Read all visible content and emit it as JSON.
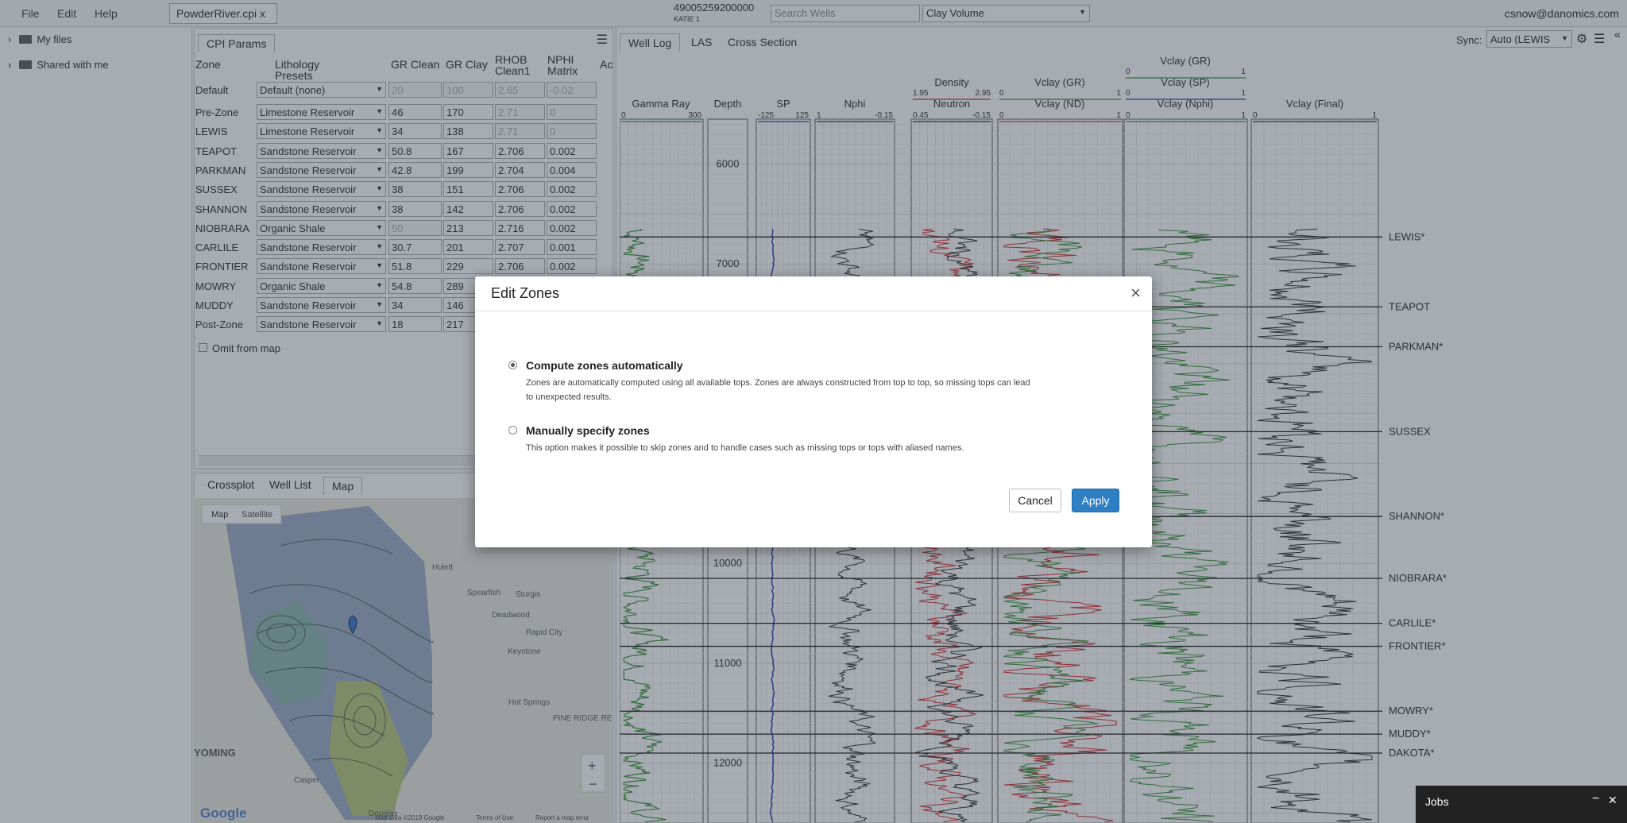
{
  "menu": {
    "file": "File",
    "edit": "Edit",
    "help": "Help"
  },
  "file_tab": "PowderRiver.cpi x",
  "well": {
    "id": "49005259200000",
    "name": "KATIE 1"
  },
  "search_placeholder": "Search Wells",
  "curve_select": "Clay Volume",
  "user": "csnow@danomics.com",
  "tree": [
    "My files",
    "Shared with me"
  ],
  "cpi": {
    "tab": "CPI Params",
    "headers": [
      "Zone",
      "Lithology Presets",
      "GR Clean",
      "GR Clay",
      "RHOB Clean1",
      "NPHI Matrix",
      "Ac"
    ],
    "rows": [
      {
        "zone": "Default",
        "preset": "Default (none)",
        "gr_clean": "20",
        "gr_clay": "100",
        "rhob": "2.65",
        "nphi": "-0.02"
      },
      {
        "zone": "Pre-Zone",
        "preset": "Limestone Reservoir",
        "gr_clean": "46",
        "gr_clay": "170",
        "rhob": "2.71",
        "nphi": "0"
      },
      {
        "zone": "LEWIS",
        "preset": "Limestone Reservoir",
        "gr_clean": "34",
        "gr_clay": "138",
        "rhob": "2.71",
        "nphi": "0"
      },
      {
        "zone": "TEAPOT",
        "preset": "Sandstone Reservoir",
        "gr_clean": "50.8",
        "gr_clay": "167",
        "rhob": "2.706",
        "nphi": "0.002"
      },
      {
        "zone": "PARKMAN",
        "preset": "Sandstone Reservoir",
        "gr_clean": "42.8",
        "gr_clay": "199",
        "rhob": "2.704",
        "nphi": "0.004"
      },
      {
        "zone": "SUSSEX",
        "preset": "Sandstone Reservoir",
        "gr_clean": "38",
        "gr_clay": "151",
        "rhob": "2.706",
        "nphi": "0.002"
      },
      {
        "zone": "SHANNON",
        "preset": "Sandstone Reservoir",
        "gr_clean": "38",
        "gr_clay": "142",
        "rhob": "2.706",
        "nphi": "0.002"
      },
      {
        "zone": "NIOBRARA",
        "preset": "Organic Shale",
        "gr_clean": "50",
        "gr_clay": "213",
        "rhob": "2.716",
        "nphi": "0.002"
      },
      {
        "zone": "CARLILE",
        "preset": "Sandstone Reservoir",
        "gr_clean": "30.7",
        "gr_clay": "201",
        "rhob": "2.707",
        "nphi": "0.001"
      },
      {
        "zone": "FRONTIER",
        "preset": "Sandstone Reservoir",
        "gr_clean": "51.8",
        "gr_clay": "229",
        "rhob": "2.706",
        "nphi": "0.002"
      },
      {
        "zone": "MOWRY",
        "preset": "Organic Shale",
        "gr_clean": "54.8",
        "gr_clay": "289",
        "rhob": "2.706",
        "nphi": "0.002"
      },
      {
        "zone": "MUDDY",
        "preset": "Sandstone Reservoir",
        "gr_clean": "34",
        "gr_clay": "146",
        "rhob": "2.706",
        "nphi": "0.002"
      },
      {
        "zone": "Post-Zone",
        "preset": "Sandstone Reservoir",
        "gr_clean": "18",
        "gr_clay": "217",
        "rhob": "2.706",
        "nphi": "0.002"
      }
    ],
    "omit_label": "Omit from map"
  },
  "bottom_tabs": [
    "Crossplot",
    "Well List",
    "Map"
  ],
  "map": {
    "btn_map": "Map",
    "btn_sat": "Satellite",
    "places": [
      "Hulett",
      "Spearfish",
      "Sturgis",
      "Deadwood",
      "Rapid City",
      "Keystone",
      "Hot Springs",
      "PINE RIDGE RESERVATION",
      "Casper",
      "Douglas",
      "YOMING"
    ],
    "attribution": [
      "Map data ©2019 Google",
      "Terms of Use",
      "Report a map error"
    ],
    "google": "Google",
    "zoom_in": "+",
    "zoom_out": "−"
  },
  "right_tabs": [
    "Well Log",
    "LAS",
    "Cross Section"
  ],
  "sync_label": "Sync:",
  "sync_value": "Auto (LEWIS",
  "tracks": {
    "gamma": {
      "title": "Gamma Ray",
      "min": "0",
      "max": "300"
    },
    "depth": {
      "title": "Depth"
    },
    "sp": {
      "title": "SP",
      "min": "-125",
      "max": "125"
    },
    "nphi": {
      "title": "Nphi",
      "min": "1",
      "max": "-0.15"
    },
    "dens": {
      "title1": "Density",
      "min1": "1.95",
      "max1": "2.95",
      "title2": "Neutron",
      "min2": "0.45",
      "max2": "-0.15"
    },
    "vclay1": {
      "title1": "Vclay (GR)",
      "min1": "0",
      "max1": "1",
      "title2": "Vclay (ND)",
      "min2": "0",
      "max2": "1"
    },
    "vclay2": {
      "title1": "Vclay (GR)",
      "min1": "0",
      "max1": "1",
      "title2": "Vclay (SP)",
      "min2": "0",
      "max2": "1",
      "title3": "Vclay (Nphi)",
      "min3": "0",
      "max3": "1"
    },
    "vfinal": {
      "title": "Vclay (Final)",
      "min": "0",
      "max": "1"
    }
  },
  "depths": [
    "6000",
    "7000",
    "10000",
    "11000",
    "12000"
  ],
  "tops": [
    {
      "name": "LEWIS*",
      "d": 6730
    },
    {
      "name": "TEAPOT",
      "d": 7430
    },
    {
      "name": "PARKMAN*",
      "d": 7830
    },
    {
      "name": "SUSSEX",
      "d": 8680
    },
    {
      "name": "SHANNON*",
      "d": 9530
    },
    {
      "name": "NIOBRARA*",
      "d": 10150
    },
    {
      "name": "CARLILE*",
      "d": 10600
    },
    {
      "name": "FRONTIER*",
      "d": 10830
    },
    {
      "name": "MOWRY*",
      "d": 11480
    },
    {
      "name": "MUDDY*",
      "d": 11710
    },
    {
      "name": "DAKOTA*",
      "d": 11900
    }
  ],
  "colors": {
    "gr": "#2f8a2f",
    "sp": "#2233aa",
    "red": "#cc2222",
    "black": "#222222",
    "primary": "#2f7fc4"
  },
  "modal": {
    "title": "Edit Zones",
    "close": "×",
    "opt1_label": "Compute zones automatically",
    "opt1_desc1": "Zones are automatically computed using all available tops. Zones are always constructed from top to top, so missing tops can lead",
    "opt1_desc2": "to unexpected results.",
    "opt2_label": "Manually specify zones",
    "opt2_desc": "This option makes it possible to skip zones and to handle cases such as missing tops or tops with aliased names.",
    "cancel": "Cancel",
    "apply": "Apply",
    "selected": "auto"
  },
  "jobs": {
    "label": "Jobs",
    "min": "−",
    "close": "✕"
  }
}
